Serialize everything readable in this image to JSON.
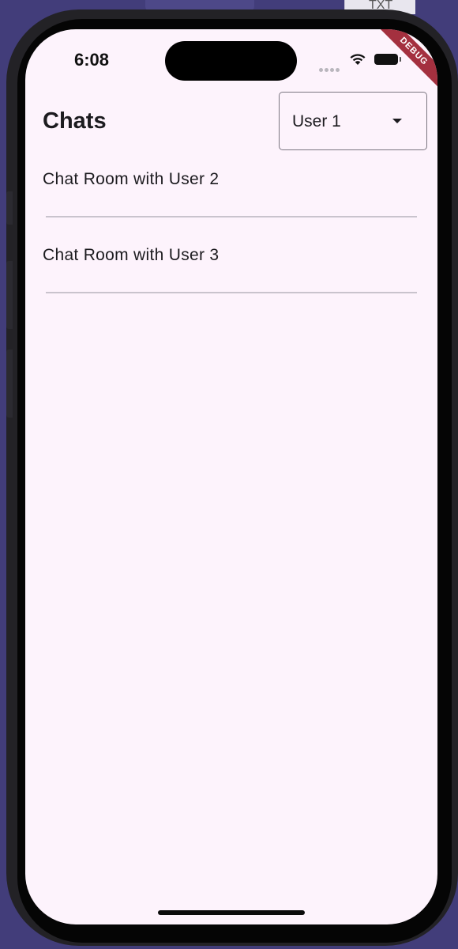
{
  "background": {
    "doc_label": "TXT"
  },
  "status_bar": {
    "time": "6:08",
    "debug_banner": "DEBUG"
  },
  "header": {
    "title": "Chats",
    "user_dropdown": {
      "selected": "User 1"
    }
  },
  "chats": [
    {
      "label": "Chat Room with User 2"
    },
    {
      "label": "Chat Room with User 3"
    }
  ],
  "colors": {
    "screen_background": "#fdf3fc",
    "desktop_background": "#423d7a",
    "debug_ribbon": "#a4303f",
    "divider": "#c9c3cd"
  }
}
